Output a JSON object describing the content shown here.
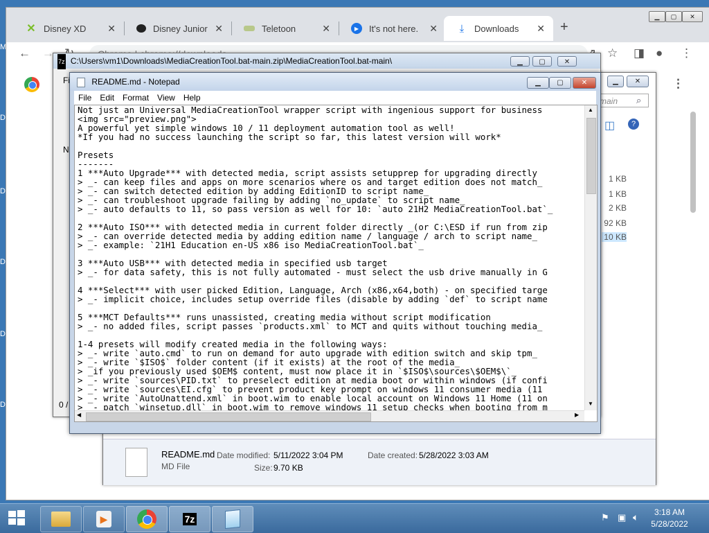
{
  "desktop": {
    "edge_letters": [
      "M",
      "D",
      "D",
      "D",
      "D",
      "D"
    ]
  },
  "chrome": {
    "tabs": [
      {
        "title": "Disney XD",
        "icon": "disney-xd-icon",
        "active": false
      },
      {
        "title": "Disney Junior",
        "icon": "disney-junior-icon",
        "active": false
      },
      {
        "title": "Teletoon",
        "icon": "teletoon-icon",
        "active": false
      },
      {
        "title": "It's not here.",
        "icon": "play-icon",
        "active": false
      },
      {
        "title": "Downloads",
        "icon": "download-icon",
        "active": true
      }
    ],
    "omnibox_text": "Chrome  |  chrome://downloads",
    "new_tab_symbol": "+"
  },
  "sevenzip": {
    "title": "C:\\Users\\vm1\\Downloads\\MediaCreationTool.bat-main.zip\\MediaCreationTool.bat-main\\",
    "menu_first": "Fi",
    "list_first": "N",
    "status": "0 /"
  },
  "explorer": {
    "search_placeholder": "main",
    "file_sizes": [
      "1 KB",
      "1 KB",
      "2 KB",
      "92 KB",
      "10 KB"
    ],
    "details": {
      "file_name": "README.md",
      "file_type": "MD File",
      "date_modified_label": "Date modified:",
      "date_modified_value": "5/11/2022 3:04 PM",
      "size_label": "Size:",
      "size_value": "9.70 KB",
      "date_created_label": "Date created:",
      "date_created_value": "5/28/2022 3:03 AM"
    }
  },
  "notepad": {
    "title": "README.md - Notepad",
    "menu": [
      "File",
      "Edit",
      "Format",
      "View",
      "Help"
    ],
    "lines": [
      "Not just an Universal MediaCreationTool wrapper script with ingenious support for business",
      "<img src=\"preview.png\">",
      "A powerful yet simple windows 10 / 11 deployment automation tool as well!",
      "*If you had no success launching the script so far, this latest version will work*",
      "",
      "Presets",
      "-------",
      "1 ***Auto Upgrade*** with detected media, script assists setupprep for upgrading directly",
      "> _- can keep files and apps on more scenarios where os and target edition does not match_",
      "> _- can switch detected edition by adding EditionID to script name_",
      "> _- can troubleshoot upgrade failing by adding `no_update` to script name_",
      "> _- auto defaults to 11, so pass version as well for 10: `auto 21H2 MediaCreationTool.bat`_",
      "",
      "2 ***Auto ISO*** with detected media in current folder directly _(or C:\\ESD if run from zip",
      "> _- can override detected media by adding edition name / language / arch to script name_",
      "> _- example: `21H1 Education en-US x86 iso MediaCreationTool.bat`_",
      "",
      "3 ***Auto USB*** with detected media in specified usb target",
      "> _- for data safety, this is not fully automated - must select the usb drive manually in G",
      "",
      "4 ***Select*** with user picked Edition, Language, Arch (x86,x64,both) - on specified targe",
      "> _- implicit choice, includes setup override files (disable by adding `def` to script name",
      "",
      "5 ***MCT Defaults*** runs unassisted, creating media without script modification",
      "> _- no added files, script passes `products.xml` to MCT and quits without touching media_",
      "",
      "1-4 presets will modify created media in the following ways:",
      "> _- write `auto.cmd` to run on demand for auto upgrade with edition switch and skip tpm_",
      "> _- write `$ISO$` folder content (if it exists) at the root of the media_",
      "> _if you previously used $OEM$ content, must now place it in `$ISO$\\sources\\$OEM$\\`_",
      "> _- write `sources\\PID.txt` to preselect edition at media boot or within windows (if confi",
      "> _- write `sources\\EI.cfg` to prevent product key prompt on windows 11 consumer media (11",
      "> _- write `AutoUnattend.xml` in boot.wim to enable local account on Windows 11 Home (11 on",
      "> _- patch `winsetup.dll` in boot.wim to remove windows 11 setup checks when booting from m"
    ]
  },
  "taskbar": {
    "apps": [
      "file-explorer-icon",
      "media-player-icon",
      "chrome-icon",
      "7zip-icon",
      "notepad-icon"
    ],
    "time": "3:18 AM",
    "date": "5/28/2022"
  }
}
